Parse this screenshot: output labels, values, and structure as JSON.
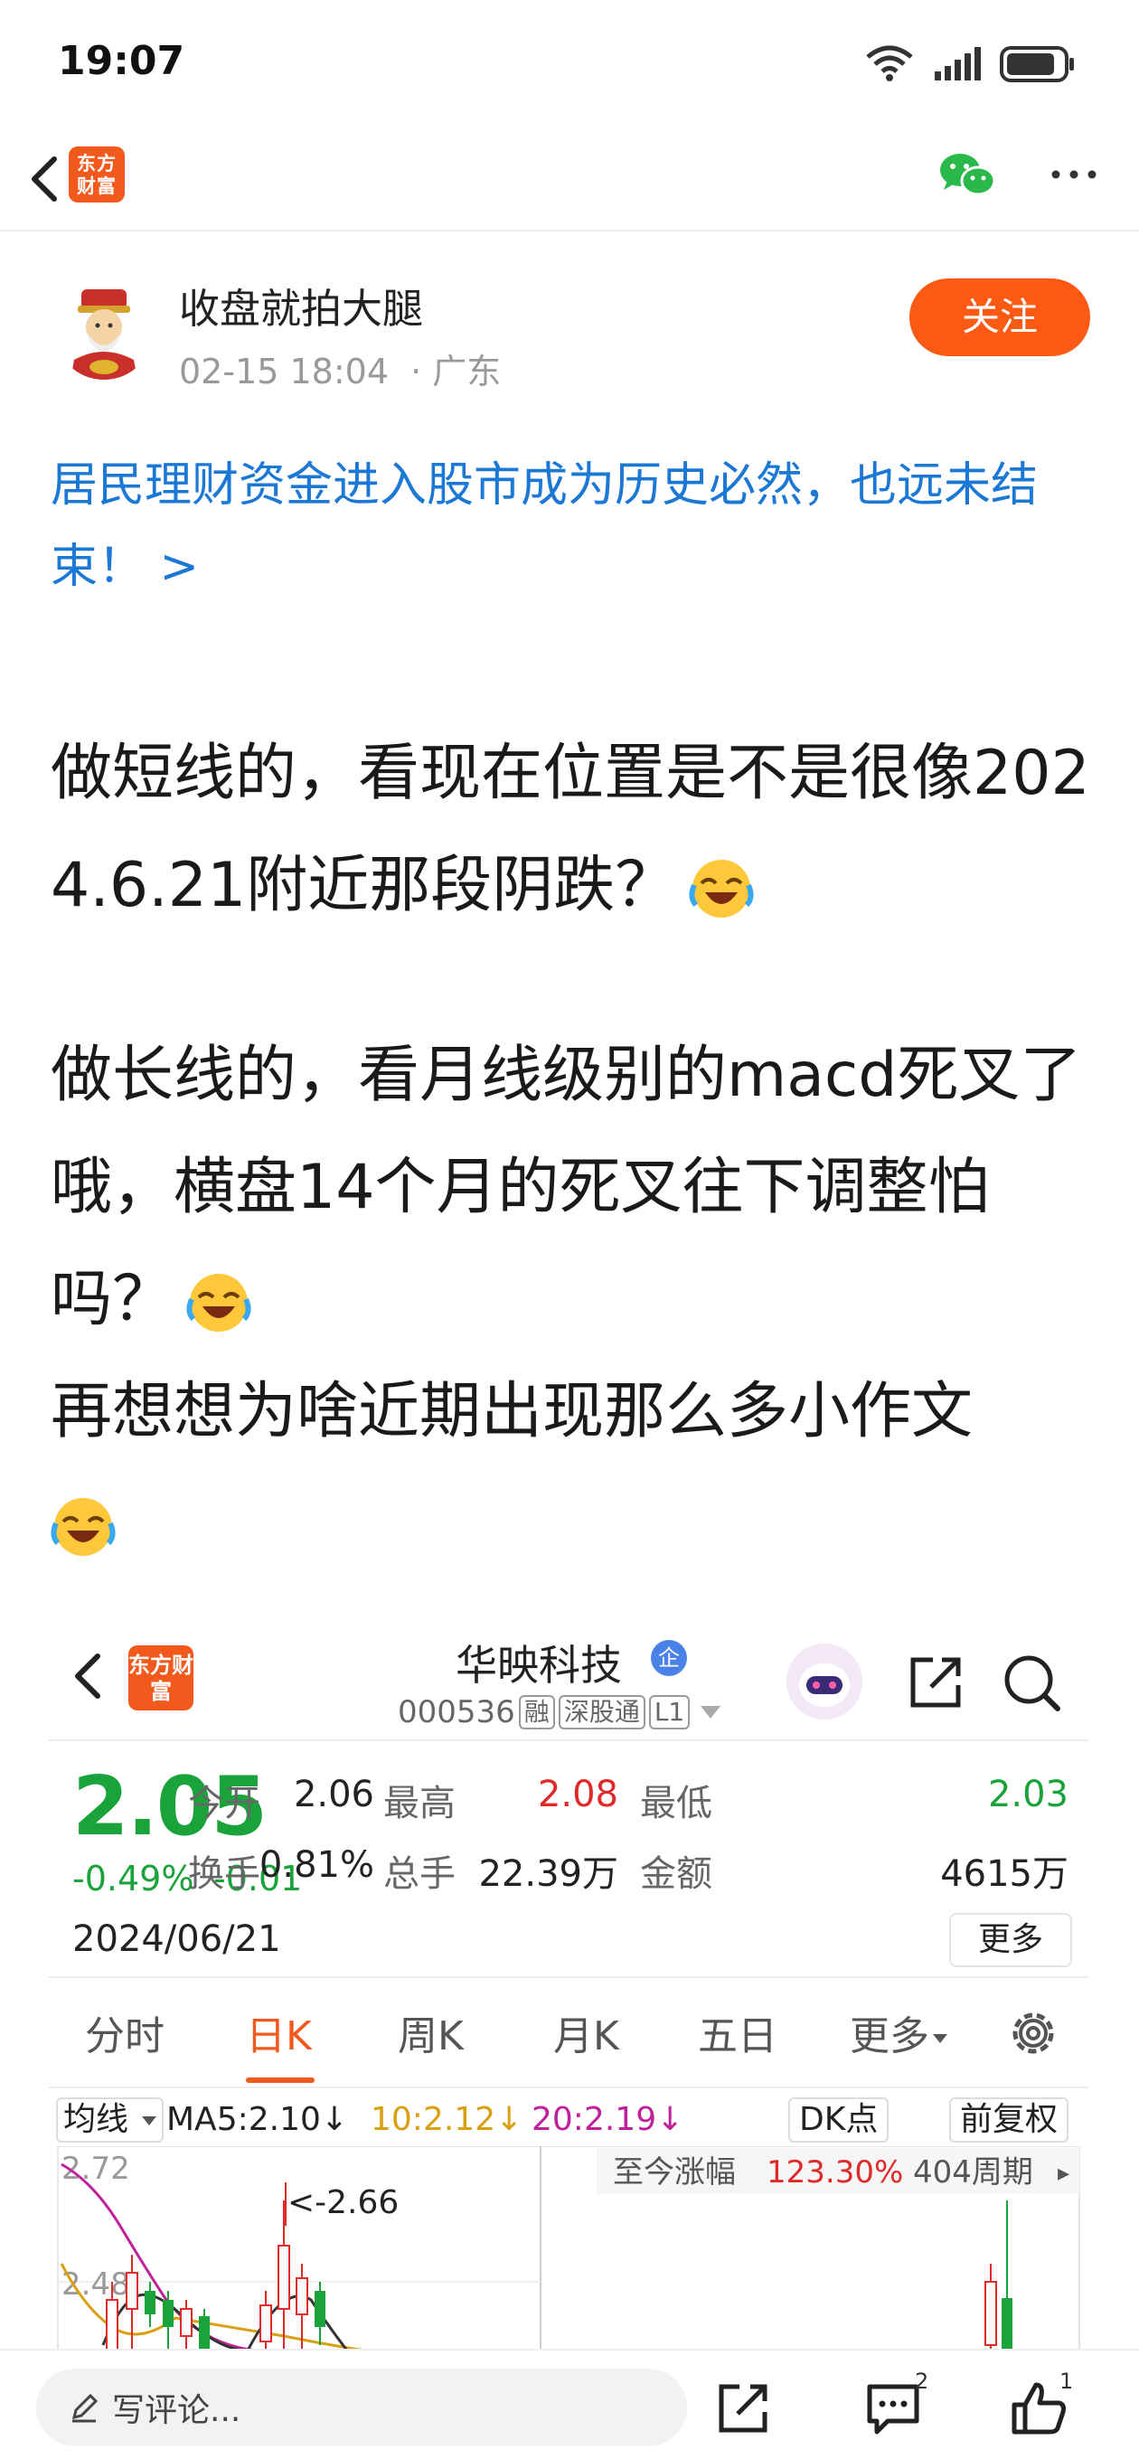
{
  "status_bar": {
    "time": "19:07",
    "battery_percent": 80
  },
  "nav": {
    "app_logo": "东方财富",
    "icons": [
      "back-arrow-icon",
      "wechat-icon",
      "more-dots-icon"
    ]
  },
  "post": {
    "author": "收盘就拍大腿",
    "date": "02-15 18:04",
    "location": "· 广东",
    "follow_label": "关注",
    "topic": "居民理财资金进入股市成为历史必然，也远未结束！ >",
    "paragraphs": [
      "做短线的，看现在位置是不是很像2024.6.21附近那段阴跌？",
      "做长线的，看月线级别的macd死叉了哦，横盘14个月的死叉往下调整怕吗？",
      "再想想为啥近期出现那么多小作文"
    ],
    "emoji": "laughing-crying-emoji"
  },
  "screenshot": {
    "app_logo": "东方财富",
    "stock_name": "华映科技",
    "stock_badge": "企",
    "stock_code": "000536",
    "tags": [
      "融",
      "深股通",
      "L1"
    ],
    "price": "2.05",
    "change_pct": "-0.49%",
    "change_abs": "-0.01",
    "date": "2024/06/21",
    "quotes": {
      "open_label": "今开",
      "open": "2.06",
      "high_label": "最高",
      "high": "2.08",
      "low_label": "最低",
      "low": "2.03",
      "turnover_label": "换手",
      "turnover": "0.81%",
      "volume_label": "总手",
      "volume": "22.39万",
      "amount_label": "金额",
      "amount": "4615万"
    },
    "more_label": "更多",
    "tabs": [
      "分时",
      "日K",
      "周K",
      "月K",
      "五日",
      "更多"
    ],
    "active_tab": "日K",
    "ma_label": "均线",
    "ma5": "MA5:2.10↓",
    "ma10": "10:2.12↓",
    "ma20": "20:2.19↓",
    "dk_label": "DK点",
    "fq_label": "前复权",
    "chart_top": "2.72",
    "chart_mid": "2.48",
    "annotation": "<-2.66",
    "gain_label": "至今涨幅",
    "gain_value": "123.30%",
    "period_label": "404周期"
  },
  "bottom_bar": {
    "comment_placeholder": "写评论...",
    "comment_count": "2",
    "like_count": "1"
  },
  "colors": {
    "link_blue": "#1b78d4",
    "accent_orange": "#fa5a14",
    "down_green": "#1aa33a",
    "up_red": "#e02a2a"
  }
}
